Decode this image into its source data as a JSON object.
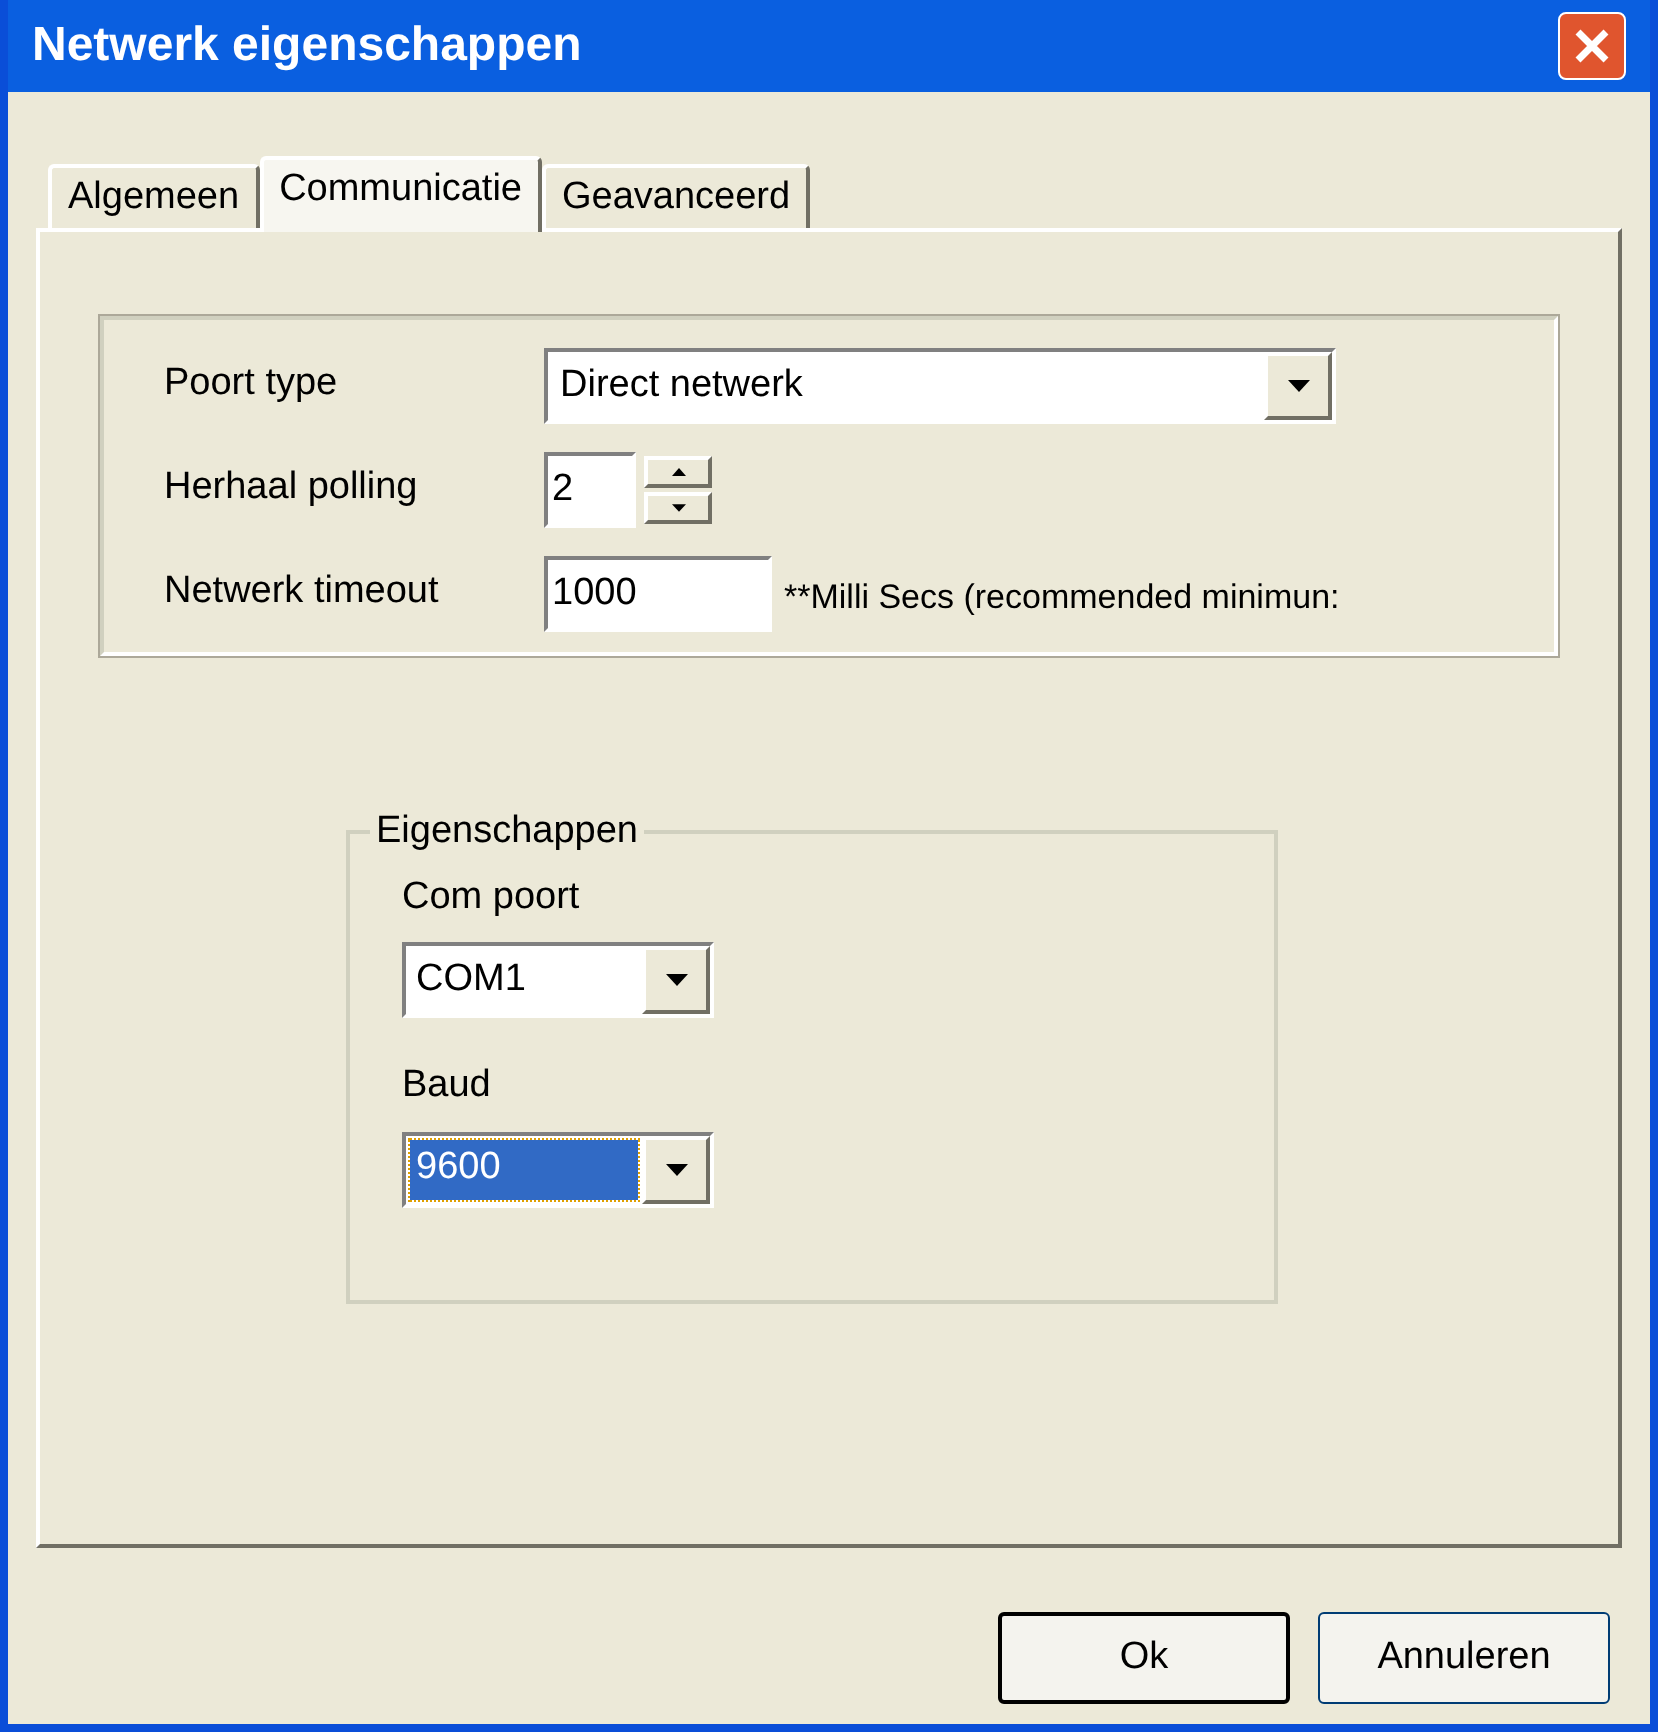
{
  "window": {
    "title": "Netwerk eigenschappen"
  },
  "tabs": [
    {
      "label": "Algemeen",
      "selected": false
    },
    {
      "label": "Communicatie",
      "selected": true
    },
    {
      "label": "Geavanceerd",
      "selected": false
    }
  ],
  "settings": {
    "port_type": {
      "label": "Poort type",
      "value": "Direct netwerk"
    },
    "polling": {
      "label": "Herhaal polling",
      "value": "2"
    },
    "timeout": {
      "label": "Netwerk timeout",
      "value": "1000",
      "note": "**Milli Secs (recommended minimun:"
    }
  },
  "properties": {
    "title": "Eigenschappen",
    "fields": [
      {
        "label": "Com poort",
        "value": "COM1",
        "focused": false
      },
      {
        "label": "Baud",
        "value": "9600",
        "focused": true
      }
    ]
  },
  "buttons": [
    {
      "label": "Ok",
      "default": true
    },
    {
      "label": "Annuleren",
      "default": false
    }
  ]
}
